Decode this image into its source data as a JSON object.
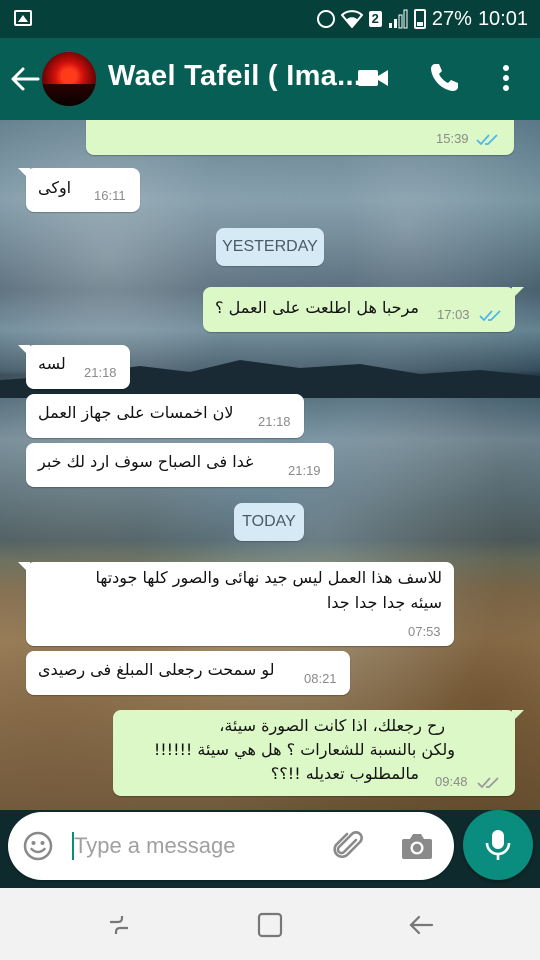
{
  "status_bar": {
    "notification_badge": "2",
    "battery": "27%",
    "time": "10:01",
    "icons": [
      "image-icon",
      "alarm-icon",
      "wifi-icon",
      "signal-icon",
      "battery-icon"
    ]
  },
  "header": {
    "contact_name": "Wael Tafeil ( Ima...",
    "icons": [
      "back-arrow-icon",
      "video-call-icon",
      "phone-icon",
      "more-vert-icon"
    ],
    "colors": {
      "app_bar": "#075e54",
      "status_bar": "#05403a"
    }
  },
  "messages": [
    {
      "type": "out",
      "text": "",
      "time": "15:39",
      "ticks": "read"
    },
    {
      "type": "in",
      "text": "اوكى",
      "time": "16:11"
    },
    {
      "type": "day",
      "text": "YESTERDAY"
    },
    {
      "type": "out",
      "text": "مرحبا هل اطلعت على العمل ؟",
      "time": "17:03",
      "ticks": "read"
    },
    {
      "type": "in",
      "text": "لسه",
      "time": "21:18"
    },
    {
      "type": "in",
      "text": "لان اخمسات على جهاز العمل",
      "time": "21:18"
    },
    {
      "type": "in",
      "text": "غدا فى الصباح سوف ارد لك خبر",
      "time": "21:19"
    },
    {
      "type": "day",
      "text": "TODAY"
    },
    {
      "type": "in",
      "lines": [
        "للاسف هذا العمل ليس جيد نهائى والصور كلها جودتها",
        "سيئه جدا جدا جدا"
      ],
      "time": "07:53"
    },
    {
      "type": "in",
      "text": "لو سمحت رجعلى المبلغ فى رصيدى",
      "time": "08:21"
    },
    {
      "type": "out",
      "lines": [
        "رح رجعلك، اذا كانت الصورة سيئة،",
        "ولكن بالنسبة للشعارات ؟ هل هي سيئة !!!!!!",
        "مالمطلوب تعديله !!؟؟"
      ],
      "time": "09:48",
      "ticks": "delivered"
    }
  ],
  "input": {
    "placeholder": "Type a message",
    "icons": [
      "emoji-icon",
      "attach-icon",
      "camera-icon",
      "mic-icon"
    ]
  },
  "colors": {
    "incoming_bubble": "#ffffff",
    "outgoing_bubble": "#dcf8c6",
    "accent": "#0a8c7e",
    "read_ticks": "#4fb6ec"
  }
}
